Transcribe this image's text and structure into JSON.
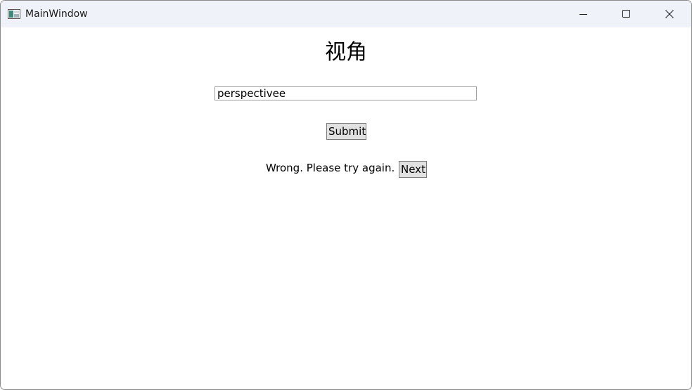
{
  "window": {
    "title": "MainWindow",
    "app_icon": "app-window-icon",
    "controls": {
      "minimize_icon": "minimize-icon",
      "maximize_icon": "maximize-icon",
      "close_icon": "close-icon"
    }
  },
  "quiz": {
    "prompt": "视角",
    "answer_value": "perspectivee",
    "submit_label": "Submit",
    "feedback": "Wrong. Please try again.",
    "next_label": "Next"
  }
}
